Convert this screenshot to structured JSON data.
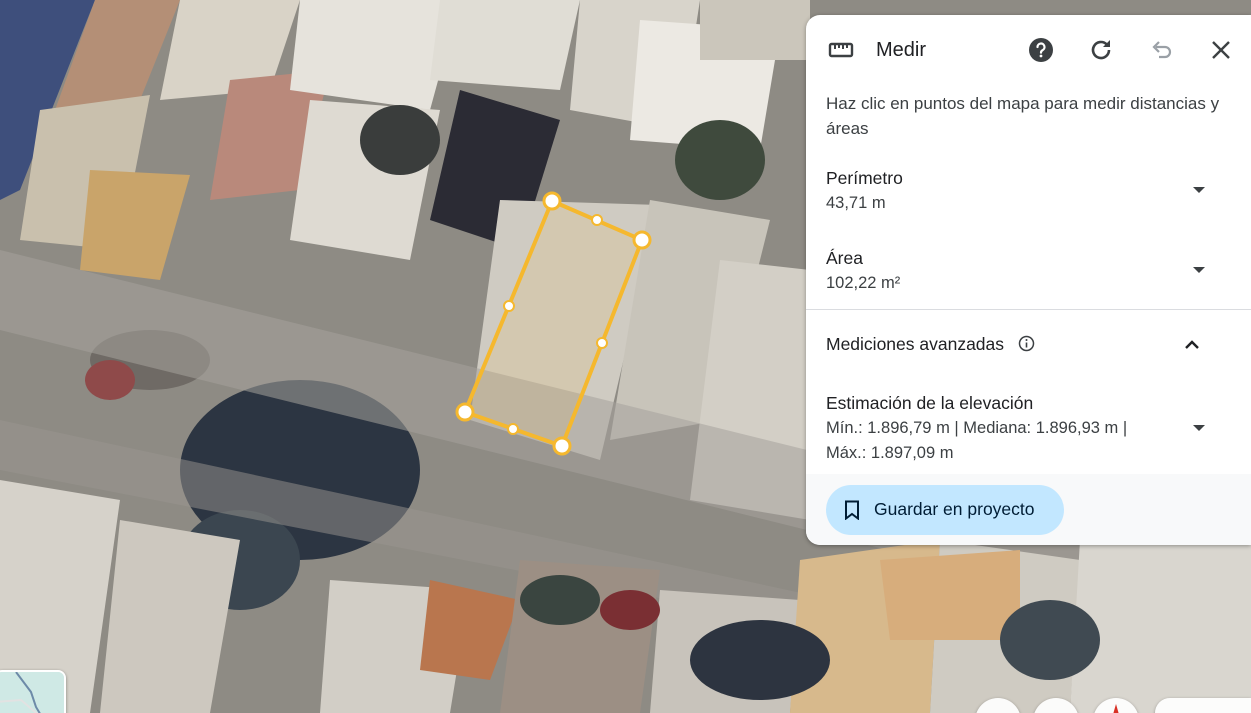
{
  "panel": {
    "title": "Medir",
    "title_icon": "ruler-icon",
    "header_icons": [
      "help-icon",
      "refresh-icon",
      "undo-icon",
      "close-icon"
    ],
    "hint": "Haz clic en puntos del mapa para medir distancias y áreas",
    "perimeter": {
      "label": "Perímetro",
      "value": "43,71 m"
    },
    "area": {
      "label": "Área",
      "value": "102,22 m²"
    },
    "advanced": {
      "title": "Mediciones avanzadas",
      "elevation": {
        "label": "Estimación de la elevación",
        "line1": "Mín.: 1.896,79 m | Mediana: 1.896,93 m |",
        "line2": "Máx.: 1.897,09 m"
      }
    },
    "save_label": "Guardar en proyecto"
  },
  "colors": {
    "polygon": "#f5b82e",
    "save_button": "#c2e7ff",
    "panel_bg": "#ffffff"
  }
}
